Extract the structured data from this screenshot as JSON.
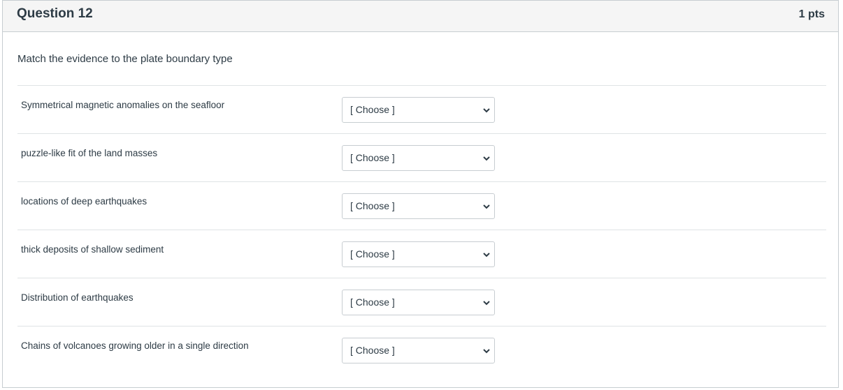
{
  "question": {
    "title": "Question 12",
    "points": "1 pts",
    "text": "Match the evidence to the plate boundary type"
  },
  "answers": [
    {
      "label": "Symmetrical magnetic anomalies on the seafloor",
      "selected": "[ Choose ]"
    },
    {
      "label": "puzzle-like fit of the land masses",
      "selected": "[ Choose ]"
    },
    {
      "label": "locations of deep earthquakes",
      "selected": "[ Choose ]"
    },
    {
      "label": "thick deposits of shallow sediment",
      "selected": "[ Choose ]"
    },
    {
      "label": "Distribution of earthquakes",
      "selected": "[ Choose ]"
    },
    {
      "label": "Chains of volcanoes growing older in a single direction",
      "selected": "[ Choose ]"
    }
  ],
  "icons": {
    "dropdown": "chevron-down-icon"
  },
  "colors": {
    "header_bg": "#f5f5f5",
    "border": "#c7cdd1",
    "text": "#2d3b45"
  }
}
